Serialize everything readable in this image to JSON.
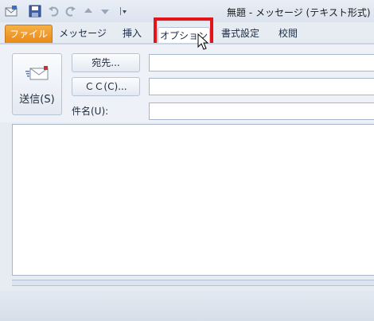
{
  "window": {
    "title": "無題 - メッセージ (テキスト形式)"
  },
  "quick_access": [
    {
      "icon": "envelope-app-icon"
    },
    {
      "icon": "save-icon"
    },
    {
      "icon": "undo-icon"
    },
    {
      "icon": "redo-icon"
    },
    {
      "icon": "up-arrow-icon"
    },
    {
      "icon": "down-arrow-icon"
    },
    {
      "icon": "customize-dropdown-icon"
    }
  ],
  "tabs": {
    "file": "ファイル",
    "message": "メッセージ",
    "insert": "挿入",
    "options": "オプション",
    "format": "書式設定",
    "review": "校閲"
  },
  "header": {
    "send_label": "送信(S)",
    "to_label": "宛先...",
    "cc_label": "ＣＣ(C)...",
    "subject_label": "件名(U):",
    "to_value": "",
    "cc_value": "",
    "subject_value": ""
  },
  "colors": {
    "file_tab": "#e8891a",
    "highlight": "#e5141b"
  }
}
